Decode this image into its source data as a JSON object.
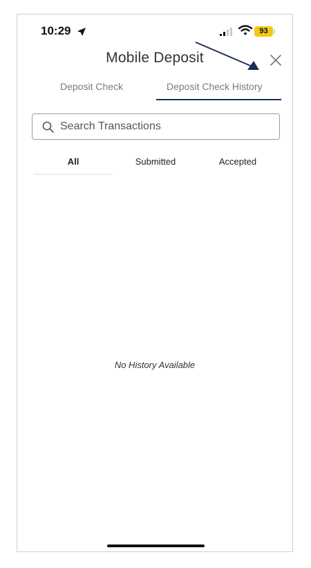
{
  "status_bar": {
    "time": "10:29",
    "battery": "93",
    "location_icon": "location-arrow-icon",
    "signal_icon": "cellular-signal-icon",
    "wifi_icon": "wifi-icon"
  },
  "header": {
    "title": "Mobile Deposit",
    "close_icon": "close-icon"
  },
  "tabs": [
    {
      "label": "Deposit Check",
      "active": false
    },
    {
      "label": "Deposit Check History",
      "active": true
    }
  ],
  "search": {
    "placeholder": "Search Transactions",
    "icon": "search-icon"
  },
  "filters": [
    {
      "label": "All",
      "active": true
    },
    {
      "label": "Submitted",
      "active": false
    },
    {
      "label": "Accepted",
      "active": false
    }
  ],
  "empty_state": "No History Available",
  "colors": {
    "accent": "#1d2d55",
    "battery": "#f4c518",
    "border": "#9a9a9a",
    "muted_text": "#7a7a7a"
  }
}
